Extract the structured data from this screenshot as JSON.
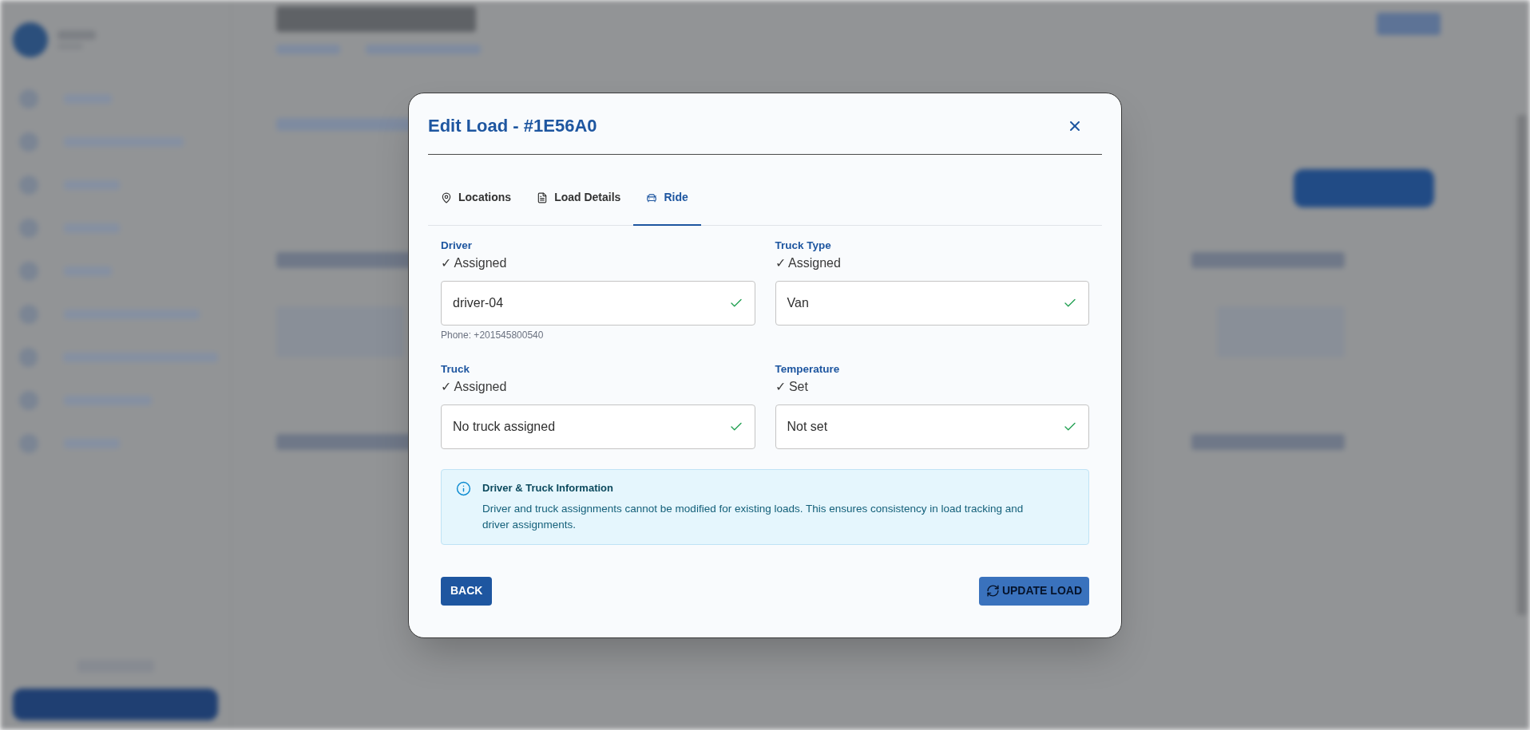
{
  "dialog": {
    "title": "Edit Load - #1E56A0"
  },
  "tabs": [
    {
      "label": "Locations",
      "selected": false
    },
    {
      "label": "Load Details",
      "selected": false
    },
    {
      "label": "Ride",
      "selected": true
    }
  ],
  "fields": [
    {
      "label": "Driver",
      "status": "✓ Assigned",
      "value": "driver-04",
      "valid": true,
      "hint": "Phone: +201545800540"
    },
    {
      "label": "Truck Type",
      "status": "✓ Assigned",
      "value": "Van",
      "valid": true
    },
    {
      "label": "Truck",
      "status": "✓ Assigned",
      "value": "No truck assigned",
      "valid": true
    },
    {
      "label": "Temperature",
      "status": "✓ Set",
      "value": "Not set",
      "valid": true
    }
  ],
  "info": {
    "title": "Driver & Truck Information",
    "text": "Driver and truck assignments cannot be modified for existing loads. This ensures consistency in load tracking and driver assignments."
  },
  "buttons": [
    {
      "label": "BACK",
      "kind": "back",
      "loading": false
    },
    {
      "label": "UPDATE LOAD",
      "kind": "submit",
      "loading": true
    }
  ]
}
